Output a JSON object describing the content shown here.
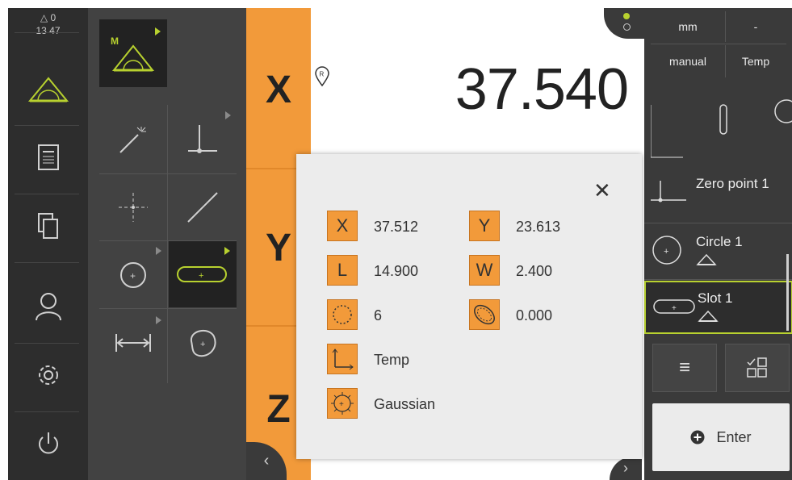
{
  "status": {
    "warnings_count": "0",
    "clock": "13 47"
  },
  "axes": {
    "x": "X",
    "y": "Y",
    "z": "Z"
  },
  "readout": {
    "x_value": "37.540",
    "ref_marker": "R"
  },
  "right_panel": {
    "tabs": [
      {
        "label": "mm"
      },
      {
        "label": "-"
      },
      {
        "label": "manual"
      },
      {
        "label": "Temp"
      }
    ],
    "features": [
      {
        "label": "Zero point 1",
        "icon": "zero-point-icon"
      },
      {
        "label": "Circle 1",
        "icon": "circle-icon"
      },
      {
        "label": "Slot 1",
        "icon": "slot-icon"
      }
    ],
    "enter_label": "Enter"
  },
  "overlay": {
    "rows": [
      {
        "icon": "X",
        "value": "37.512"
      },
      {
        "icon": "Y",
        "value": "23.613"
      },
      {
        "icon": "L",
        "value": "14.900"
      },
      {
        "icon": "W",
        "value": "2.400"
      },
      {
        "icon": "points-icon",
        "value": "6"
      },
      {
        "icon": "form-error-icon",
        "value": "0.000"
      },
      {
        "icon": "coord-system-icon",
        "value": "Temp"
      },
      {
        "icon": "fit-algorithm-icon",
        "value": "Gaussian"
      }
    ],
    "close_label": "✕"
  },
  "colors": {
    "accent": "#f29a3a",
    "highlight": "#b8d12f",
    "dark": "#2d2d2d",
    "panel": "#3a3a3a"
  }
}
